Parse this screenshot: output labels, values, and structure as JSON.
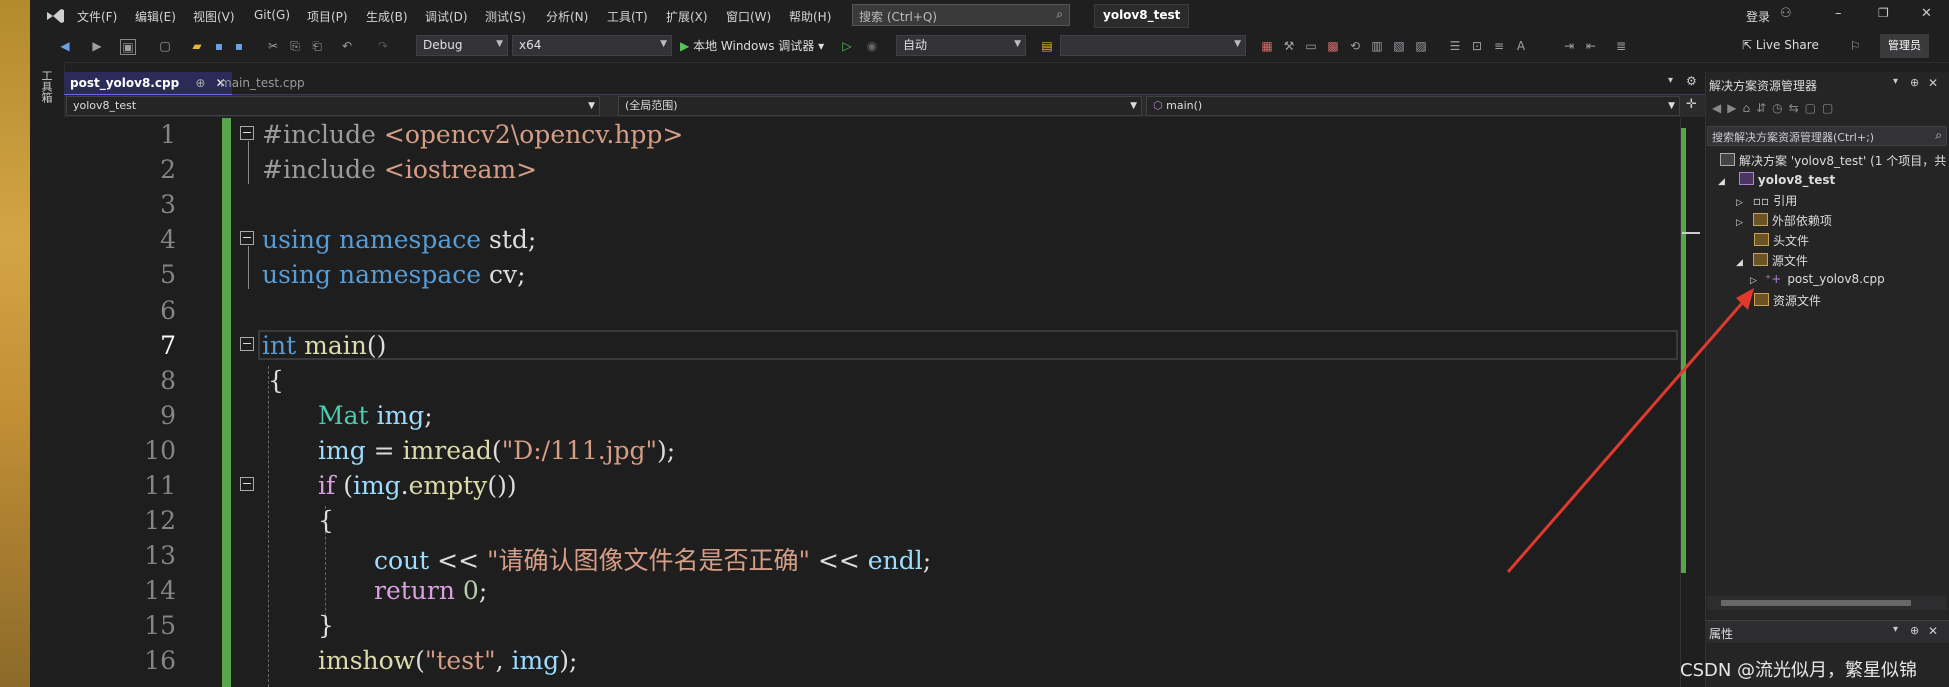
{
  "menu": {
    "items": [
      "文件(F)",
      "编辑(E)",
      "视图(V)",
      "Git(G)",
      "项目(P)",
      "生成(B)",
      "调试(D)",
      "测试(S)",
      "分析(N)",
      "工具(T)",
      "扩展(X)",
      "窗口(W)",
      "帮助(H)"
    ],
    "search_placeholder": "搜索 (Ctrl+Q)",
    "project_title": "yolov8_test",
    "signin": "登录",
    "minimize": "–",
    "restore": "❐",
    "close": "✕"
  },
  "toolbar": {
    "config": "Debug",
    "platform": "x64",
    "run_label": "本地 Windows 调试器",
    "auto": "自动",
    "live_share": "Live Share",
    "admin": "管理员"
  },
  "tabs": [
    {
      "label": "post_yolov8.cpp",
      "pin": "⊕",
      "close": "✕"
    },
    {
      "label": "main_test.cpp"
    }
  ],
  "navbar": {
    "project": "yolov8_test",
    "scope": "(全局范围)",
    "member": "main()"
  },
  "code": {
    "line_numbers": [
      "1",
      "2",
      "3",
      "4",
      "5",
      "6",
      "7",
      "8",
      "9",
      "10",
      "11",
      "12",
      "13",
      "14",
      "15",
      "16"
    ],
    "l1a": "#include",
    "l1b": "<opencv2\\opencv.hpp>",
    "l2a": "#include",
    "l2b": "<iostream>",
    "l4a": "using",
    "l4b": "namespace",
    "l4c": "std;",
    "l5a": "using",
    "l5b": "namespace",
    "l5c": "cv;",
    "l7a": "int",
    "l7b": "main",
    "l7c": "()",
    "l8": "{",
    "l9a": "Mat",
    "l9b": "img",
    "l9c": ";",
    "l10a": "img",
    "l10b": " = ",
    "l10c": "imread",
    "l10d": "(",
    "l10e": "\"D:/111.jpg\"",
    "l10f": ");",
    "l11a": "if",
    "l11b": " (",
    "l11c": "img",
    "l11d": ".",
    "l11e": "empty",
    "l11f": "())",
    "l12": "{",
    "l13a": "cout",
    "l13b": " << ",
    "l13c": "\"请确认图像文件名是否正确\"",
    "l13d": " << ",
    "l13e": "endl",
    "l13f": ";",
    "l14a": "return",
    "l14b": " 0",
    "l14c": ";",
    "l15": "}",
    "l16a": "imshow",
    "l16b": "(",
    "l16c": "\"test\"",
    "l16d": ", ",
    "l16e": "img",
    "l16f": ");"
  },
  "solution_explorer": {
    "title": "解决方案资源管理器",
    "search_placeholder": "搜索解决方案资源管理器(Ctrl+;)",
    "solution": "解决方案 'yolov8_test' (1 个项目，共",
    "project": "yolov8_test",
    "items": [
      "引用",
      "外部依赖项",
      "头文件",
      "源文件",
      "post_yolov8.cpp",
      "资源文件"
    ]
  },
  "properties": {
    "title": "属性"
  },
  "left_strip": {
    "label": "工具箱"
  },
  "watermark": "CSDN @流光似月，繁星似锦"
}
